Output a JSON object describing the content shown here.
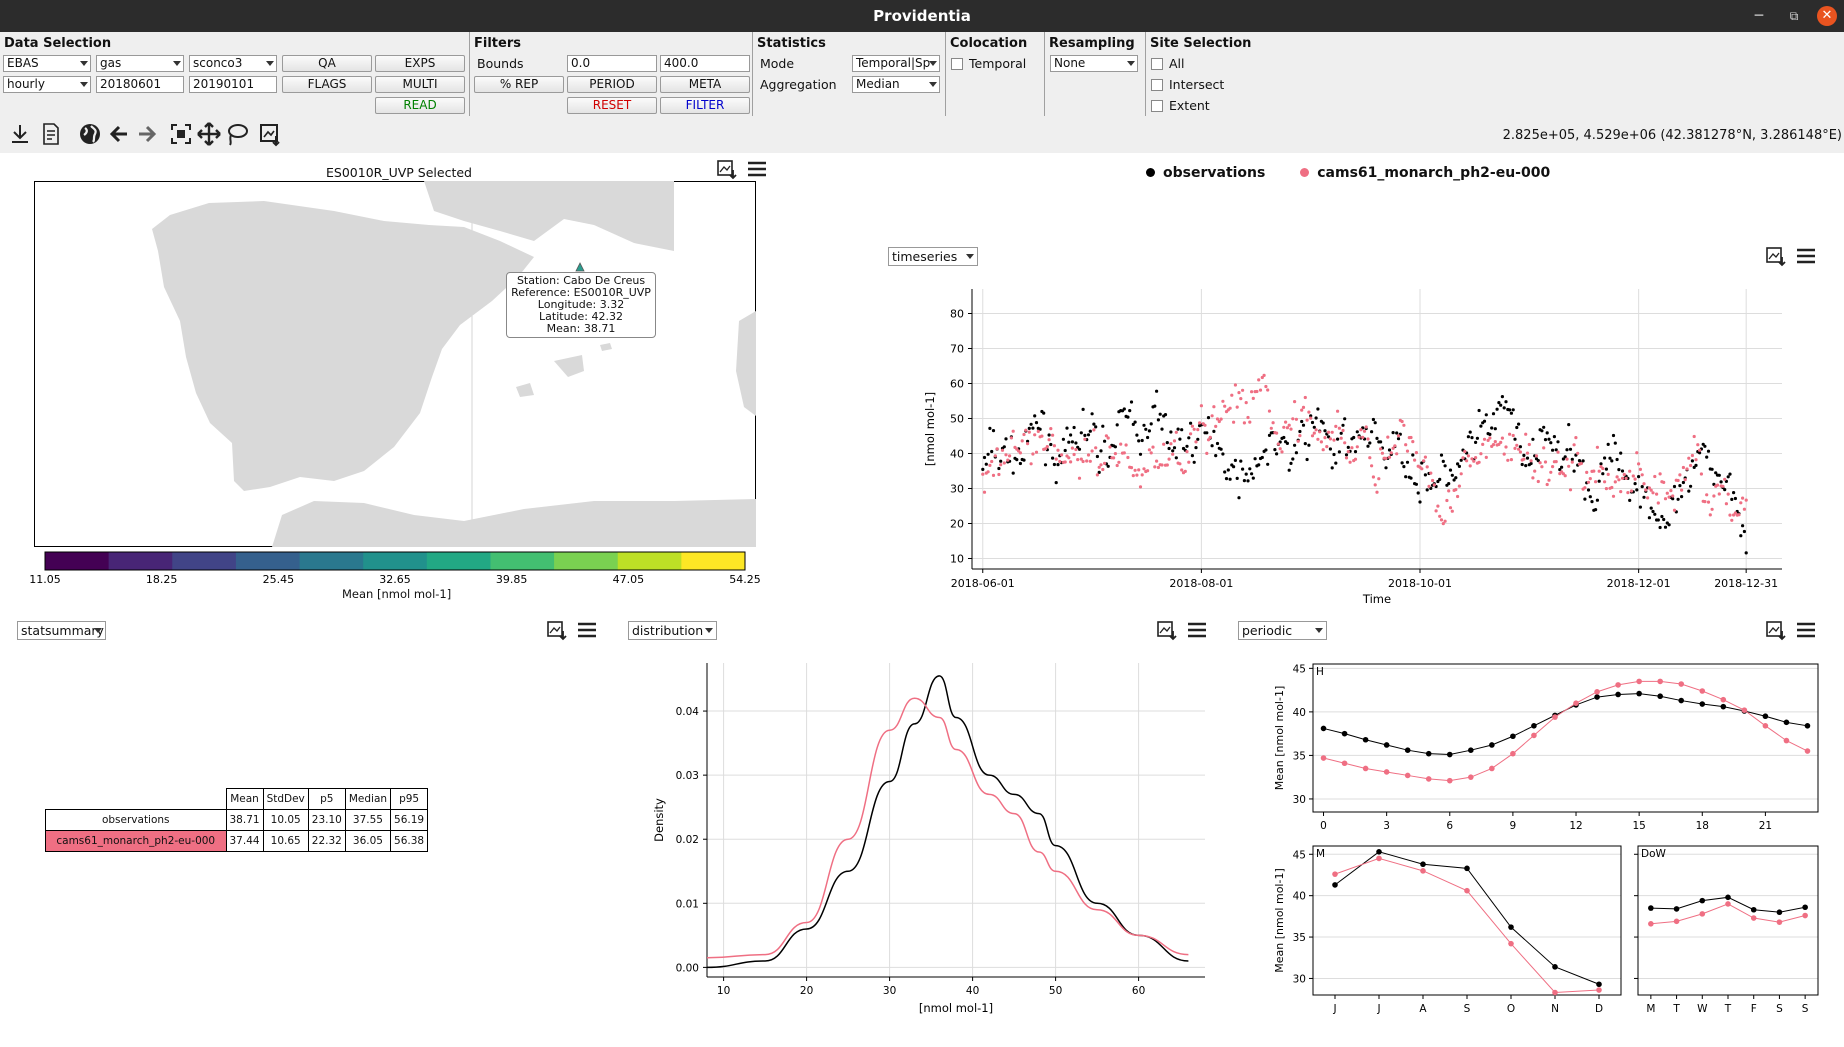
{
  "window": {
    "title": "Providentia",
    "minimize": "─",
    "maximize": "⧉",
    "close": "✕"
  },
  "data_selection": {
    "title": "Data Selection",
    "network": "EBAS",
    "resolution": "hourly",
    "matrix": "gas",
    "species": "sconco3",
    "start_date": "20180601",
    "end_date": "20190101",
    "buttons": {
      "qa": "QA",
      "flags": "FLAGS",
      "exps": "EXPS",
      "multi": "MULTI",
      "read": "READ"
    }
  },
  "filters": {
    "title": "Filters",
    "bounds_label": "Bounds",
    "bound_low": "0.0",
    "bound_high": "400.0",
    "buttons": {
      "rep": "% REP",
      "period": "PERIOD",
      "meta": "META",
      "reset": "RESET",
      "filter": "FILTER"
    }
  },
  "statistics": {
    "title": "Statistics",
    "mode_label": "Mode",
    "mode_value": "Temporal|Sp",
    "aggregation_label": "Aggregation",
    "aggregation_value": "Median"
  },
  "colocation": {
    "title": "Colocation",
    "temporal_label": "Temporal"
  },
  "resampling": {
    "title": "Resampling",
    "value": "None"
  },
  "site_selection": {
    "title": "Site Selection",
    "all": "All",
    "intersect": "Intersect",
    "extent": "Extent"
  },
  "toolbar": {
    "icons": [
      "download-icon",
      "report-icon",
      "globe-icon",
      "back-arrow-icon",
      "forward-arrow-icon",
      "zoom-icon",
      "pan-icon",
      "lasso-icon",
      "save-figure-icon"
    ]
  },
  "coords_readout": "2.825e+05, 4.529e+06 (42.381278°N, 3.286148°E)",
  "map": {
    "title": "ES0010R_UVP Selected",
    "tooltip": {
      "station": "Station: Cabo De Creus",
      "reference": "Reference: ES0010R_UVP",
      "longitude": "Longitude: 3.32",
      "latitude": "Latitude: 42.32",
      "mean": "Mean: 38.71"
    },
    "colorbar": {
      "ticks": [
        "11.05",
        "18.25",
        "25.45",
        "32.65",
        "39.85",
        "47.05",
        "54.25"
      ],
      "label": "Mean [nmol mol-1]",
      "colors": [
        "#440154",
        "#482576",
        "#414487",
        "#35608d",
        "#2a788e",
        "#21918c",
        "#22a884",
        "#43bf71",
        "#7ad151",
        "#bddf26",
        "#fde725"
      ]
    }
  },
  "legend": {
    "observations": "observations",
    "model": "cams61_monarch_ph2-eu-000"
  },
  "colors": {
    "observations": "#000000",
    "model": "#ef6f83",
    "reset": "#d00000",
    "filter": "#0000cc",
    "read": "#008000"
  },
  "timeseries": {
    "selector": "timeseries"
  },
  "statsummary": {
    "selector": "statsummary",
    "headers": [
      "Mean",
      "StdDev",
      "p5",
      "Median",
      "p95"
    ],
    "rows": [
      {
        "name": "observations",
        "values": [
          "38.71",
          "10.05",
          "23.10",
          "37.55",
          "56.19"
        ]
      },
      {
        "name": "cams61_monarch_ph2-eu-000",
        "values": [
          "37.44",
          "10.65",
          "22.32",
          "36.05",
          "56.38"
        ]
      }
    ]
  },
  "distribution": {
    "selector": "distribution"
  },
  "periodic": {
    "selector": "periodic"
  },
  "chart_data": [
    {
      "type": "scatter",
      "name": "timeseries",
      "xlabel": "Time",
      "ylabel": "[nmol mol-1]",
      "x_ticks": [
        "2018-06-01",
        "2018-08-01",
        "2018-10-01",
        "2018-12-01",
        "2018-12-31"
      ],
      "y_ticks": [
        10,
        20,
        30,
        40,
        50,
        60,
        70,
        80
      ],
      "ylim": [
        7,
        87
      ],
      "series": [
        {
          "name": "observations",
          "x": [
            "2018-06",
            "2018-07",
            "2018-08",
            "2018-09",
            "2018-10",
            "2018-11",
            "2018-12"
          ],
          "values": [
            37,
            42,
            44,
            40,
            38,
            33,
            32
          ]
        },
        {
          "name": "cams61_monarch_ph2-eu-000",
          "x": [
            "2018-06",
            "2018-07",
            "2018-08",
            "2018-09",
            "2018-10",
            "2018-11",
            "2018-12"
          ],
          "values": [
            36,
            43,
            45,
            40,
            36,
            31,
            31
          ]
        }
      ]
    },
    {
      "type": "line",
      "name": "distribution",
      "xlabel": "[nmol mol-1]",
      "ylabel": "Density",
      "x_ticks": [
        10,
        20,
        30,
        40,
        50,
        60
      ],
      "y_ticks": [
        "0.00",
        "0.01",
        "0.02",
        "0.03",
        "0.04"
      ],
      "xlim": [
        8,
        68
      ],
      "ylim": [
        -0.0015,
        0.0475
      ],
      "series": [
        {
          "name": "observations",
          "x": [
            8,
            15,
            20,
            25,
            30,
            33,
            36,
            38,
            42,
            45,
            48,
            50,
            55,
            60,
            66
          ],
          "values": [
            0.0,
            0.001,
            0.006,
            0.015,
            0.029,
            0.038,
            0.0455,
            0.039,
            0.03,
            0.027,
            0.024,
            0.019,
            0.01,
            0.005,
            0.001
          ]
        },
        {
          "name": "cams61_monarch_ph2-eu-000",
          "x": [
            8,
            15,
            20,
            25,
            30,
            33,
            36,
            38,
            42,
            45,
            48,
            50,
            55,
            60,
            66
          ],
          "values": [
            0.0015,
            0.002,
            0.007,
            0.02,
            0.037,
            0.042,
            0.039,
            0.034,
            0.027,
            0.024,
            0.018,
            0.015,
            0.009,
            0.005,
            0.002
          ]
        }
      ]
    },
    {
      "type": "line",
      "name": "periodic-hour",
      "panel_label": "H",
      "ylabel": "Mean [nmol mol-1]",
      "x_ticks": [
        0,
        3,
        6,
        9,
        12,
        15,
        18,
        21
      ],
      "y_ticks": [
        30,
        35,
        40,
        45
      ],
      "ylim": [
        28.5,
        45.5
      ],
      "series": [
        {
          "name": "observations",
          "x": [
            0,
            1,
            2,
            3,
            4,
            5,
            6,
            7,
            8,
            9,
            10,
            11,
            12,
            13,
            14,
            15,
            16,
            17,
            18,
            19,
            20,
            21,
            22,
            23
          ],
          "values": [
            38.1,
            37.5,
            36.8,
            36.2,
            35.6,
            35.2,
            35.1,
            35.6,
            36.2,
            37.2,
            38.4,
            39.6,
            40.8,
            41.7,
            42.0,
            42.1,
            41.8,
            41.3,
            40.9,
            40.6,
            40.1,
            39.5,
            38.8,
            38.4
          ]
        },
        {
          "name": "cams61_monarch_ph2-eu-000",
          "x": [
            0,
            1,
            2,
            3,
            4,
            5,
            6,
            7,
            8,
            9,
            10,
            11,
            12,
            13,
            14,
            15,
            16,
            17,
            18,
            19,
            20,
            21,
            22,
            23
          ],
          "values": [
            34.7,
            34.1,
            33.5,
            33.1,
            32.7,
            32.3,
            32.1,
            32.5,
            33.5,
            35.2,
            37.3,
            39.4,
            41.0,
            42.3,
            43.1,
            43.5,
            43.5,
            43.2,
            42.4,
            41.4,
            40.2,
            38.4,
            36.7,
            35.5
          ]
        }
      ]
    },
    {
      "type": "line",
      "name": "periodic-month",
      "panel_label": "M",
      "ylabel": "Mean [nmol mol-1]",
      "x_ticks": [
        "J",
        "J",
        "A",
        "S",
        "O",
        "N",
        "D"
      ],
      "y_ticks": [
        30,
        35,
        40,
        45
      ],
      "ylim": [
        28,
        46
      ],
      "series": [
        {
          "name": "observations",
          "values": [
            41.3,
            45.3,
            43.8,
            43.3,
            36.2,
            31.4,
            29.3
          ]
        },
        {
          "name": "cams61_monarch_ph2-eu-000",
          "values": [
            42.6,
            44.5,
            43.0,
            40.6,
            34.2,
            28.3,
            28.6
          ]
        }
      ]
    },
    {
      "type": "line",
      "name": "periodic-dow",
      "panel_label": "DoW",
      "x_ticks": [
        "M",
        "T",
        "W",
        "T",
        "F",
        "S",
        "S"
      ],
      "ylim": [
        28,
        46
      ],
      "series": [
        {
          "name": "observations",
          "values": [
            38.5,
            38.4,
            39.4,
            39.8,
            38.3,
            38.0,
            38.6
          ]
        },
        {
          "name": "cams61_monarch_ph2-eu-000",
          "values": [
            36.6,
            36.9,
            37.8,
            39.0,
            37.3,
            36.8,
            37.6
          ]
        }
      ]
    }
  ]
}
